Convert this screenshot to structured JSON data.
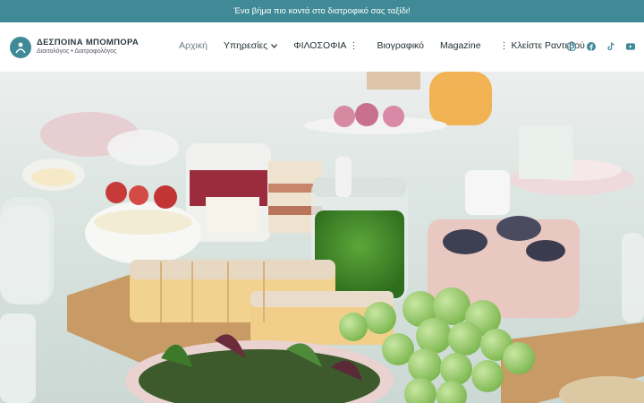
{
  "topbar": {
    "text": "Ένα βήμα πιο κοντά στο διατροφικό σας ταξίδι!"
  },
  "logo": {
    "name": "ΔΕΣΠΟΙΝΑ ΜΠΟΜΠΟΡΑ",
    "subtitle": "Διαιτολόγος • Διατροφολόγος"
  },
  "nav": {
    "home": "Αρχική",
    "services": "Υπηρεσίες",
    "philosophy": "ΦΙΛΟΣΟΦΙΑ",
    "bio": "Βιογραφικό",
    "magazine": "Magazine",
    "appointment": "Κλείστε Ραντεβού"
  },
  "social": [
    "instagram-icon",
    "facebook-icon",
    "tiktok-icon",
    "youtube-icon"
  ],
  "colors": {
    "accent": "#3f8a96",
    "text": "#1e2b2f"
  }
}
